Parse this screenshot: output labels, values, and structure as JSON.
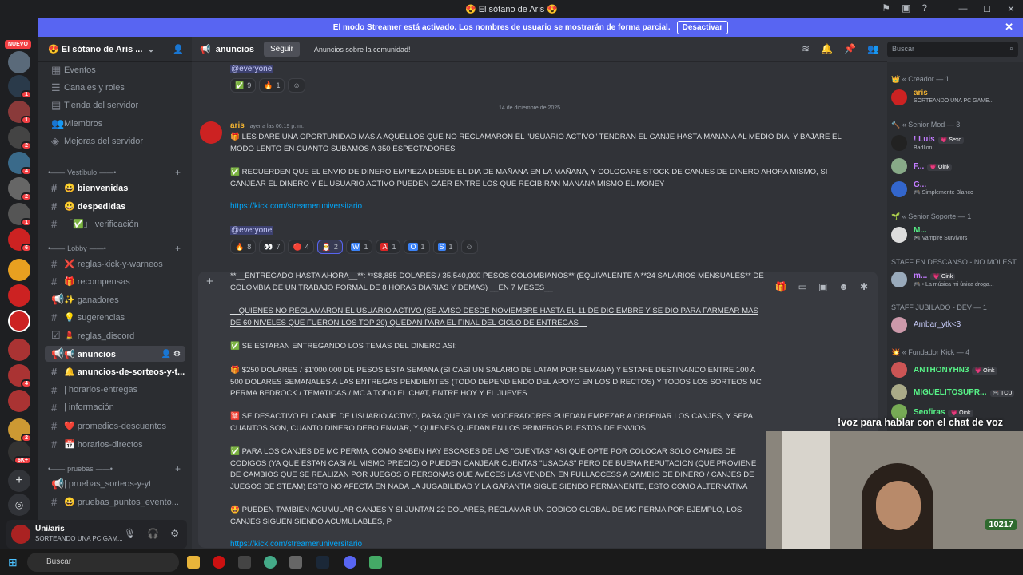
{
  "window": {
    "title": "😍 El sótano de Aris 😍"
  },
  "banner": {
    "text": "El modo Streamer está activado. Los nombres de usuario se mostrarán de forma parcial.",
    "button": "Desactivar"
  },
  "servers": {
    "new_label": "NUEVO"
  },
  "server": {
    "name": "😍 El sótano de Aris ..."
  },
  "nav": {
    "eventos": "Eventos",
    "canales": "Canales y roles",
    "tienda": "Tienda del servidor",
    "miembros": "Miembros",
    "mejoras": "Mejoras del servidor"
  },
  "categories": {
    "vestibulo": "Vestíbulo",
    "lobby": "Lobby",
    "pruebas": "pruebas"
  },
  "channels": [
    {
      "label": "😀 bienvenidas"
    },
    {
      "label": "😀 despedidas"
    },
    {
      "label": "「✅」 verificación"
    },
    {
      "label": "❌ reglas-kick-y-warneos"
    },
    {
      "label": "🎁 recompensas"
    },
    {
      "label": "✨ ganadores"
    },
    {
      "label": "💡 sugerencias"
    },
    {
      "label": "💄 reglas_discord"
    },
    {
      "label": "📢 anuncios"
    },
    {
      "label": "🔔 anuncios-de-sorteos-y-t..."
    },
    {
      "label": "| horarios-entregas"
    },
    {
      "label": "| información"
    },
    {
      "label": "❓ preguntas-frecuentes"
    },
    {
      "label": "❤️ promedios-descuentos"
    },
    {
      "label": "📅 horarios-directos"
    },
    {
      "label": "| pruebas_sorteos-y-yt"
    },
    {
      "label": "😀 pruebas_puntos_evento..."
    }
  ],
  "user": {
    "name": "Uni/aris",
    "status": "SORTEANDO UNA PC GAM..."
  },
  "channel": {
    "name": "anuncios",
    "follow": "Seguir",
    "topic": "Anuncios sobre la comunidad!"
  },
  "search": {
    "placeholder": "Buscar"
  },
  "messages": {
    "everyone": "@everyone",
    "top_reactions": [
      {
        "emoji": "✅",
        "count": "9"
      },
      {
        "emoji": "🔥",
        "count": "1"
      }
    ],
    "date_divider": "14 de diciembre de 2025",
    "author": "aris",
    "timestamp": "ayer a las 06:19 p. m.",
    "p1": "🎁 LES DARE UNA OPORTUNIDAD MAS A AQUELLOS QUE NO RECLAMARON EL \"USUARIO ACTIVO\" TENDRAN EL CANJE HASTA MAÑANA AL MEDIO DIA, Y BAJARE EL MODO LENTO EN CUANTO SUBAMOS A 350 ESPECTADORES",
    "p2": "✅ RECUERDEN QUE EL ENVIO DE DINERO EMPIEZA DESDE EL DIA DE MAÑANA EN LA MAÑANA, Y COLOCARE STOCK DE CANJES DE DINERO AHORA MISMO, SI CANJEAR EL DINERO Y EL USUARIO ACTIVO PUEDEN CAER ENTRE LOS QUE RECIBIRAN MAÑANA MISMO EL MONEY",
    "link": "https://kick.com/streameruniversitario",
    "reactions": [
      {
        "emoji": "🔥",
        "count": "8"
      },
      {
        "emoji": "👀",
        "count": "7"
      },
      {
        "emoji": "🔴",
        "count": "4"
      },
      {
        "emoji": "🎅",
        "count": "2"
      },
      {
        "emoji": "W",
        "count": "1"
      },
      {
        "emoji": "A",
        "count": "1"
      },
      {
        "emoji": "O",
        "count": "1"
      },
      {
        "emoji": "S",
        "count": "1"
      }
    ]
  },
  "draft": {
    "l1": "**__ENTREGADO HASTA AHORA__**: **$8,885 DOLARES / 35,540,000 PESOS COLOMBIANOS** (EQUIVALENTE A **24 SALARIOS MENSUALES** DE COLOMBIA DE UN TRABAJO FORMAL DE 8 HORAS DIARIAS Y DEMAS) __EN 7 MESES__",
    "l2": "__QUIENES NO RECLAMARON EL USUARIO ACTIVO (SE AVISO DESDE NOVIEMBRE HASTA EL 11 DE DICIEMBRE Y SE DIO PARA FARMEAR MAS DE 60 NIVELES QUE FUERON LOS TOP 20) QUEDAN PARA EL FINAL DEL CICLO DE ENTREGAS__",
    "l3": "✅ SE ESTARAN ENTREGANDO LOS TEMAS DEL DINERO ASI:",
    "l4": "🎁 $250 DOLARES / $1'000.000 DE PESOS ESTA SEMANA (SI CASI UN SALARIO DE LATAM POR SEMANA) Y ESTARE DESTINANDO ENTRE 100 A 500 DOLARES SEMANALES A LAS ENTREGAS PENDIENTES (TODO DEPENDIENDO DEL APOYO EN LOS DIRECTOS) Y TODOS LOS SORTEOS MC PERMA BEDROCK / TEMATICAS / MC A TODO EL CHAT, ENTRE HOY Y EL JUEVES",
    "l5": "🈲 SE DESACTIVO EL CANJE DE USUARIO ACTIVO, PARA QUE YA LOS MODERADORES PUEDAN EMPEZAR A ORDENAR LOS CANJES, Y SEPA CUANTOS SON, CUANTO DINERO DEBO ENVIAR, Y QUIENES QUEDAN EN LOS PRIMEROS PUESTOS DE ENVIOS",
    "l6": "✅ PARA LOS CANJES DE MC PERMA, COMO SABEN HAY ESCASES DE LAS \"CUENTAS\" ASI QUE OPTE POR COLOCAR SOLO CANJES DE CODIGOS (YA QUE ESTAN CASI AL MISMO PRECIO) O PUEDEN CANJEAR CUENTAS \"USADAS\" PERO DE BUENA REPUTACION (QUE PROVIENE DE CAMBIOS QUE SE REALIZAN POR JUEGOS O PERSONAS QUE AVECES LAS VENDEN EN FULLACCESS A CAMBIO DE DINERO / CANJES DE JUEGOS DE STEAM) ESTO NO AFECTA EN NADA LA JUGABILIDAD Y LA GARANTIA SIGUE SIENDO PERMANENTE, ESTO COMO ALTERNATIVA",
    "l7": "🤩 PUEDEN TAMBIEN ACUMULAR CANJES Y SI JUNTAN 22 DOLARES, RECLAMAR UN CODIGO GLOBAL DE MC PERMA POR EJEMPLO, LOS CANJES SIGUEN SIENDO ACUMULABLES, P"
  },
  "members": {
    "groups": [
      "👑 « Creador — 1",
      "🔨 « Senior Mod — 3",
      "🌱 « Senior Soporte — 1",
      "STAFF EN DESCANSO - NO MOLEST...",
      "STAFF JUBILADO - DEV — 1",
      "💥 « Fundador Kick — 4"
    ],
    "list": [
      {
        "name": "aris",
        "status": "SORTEANDO UNA PC GAME...",
        "tag": "",
        "color": "#f0b232"
      },
      {
        "name": "! Luis",
        "status": "Badlion",
        "tag": "💗 Sexo",
        "color": "#c27cff"
      },
      {
        "name": "F...",
        "status": "",
        "tag": "💗 Oink",
        "color": "#c27cff"
      },
      {
        "name": "G...",
        "status": "🎮 Simplemente Blanco",
        "tag": "",
        "color": "#c27cff"
      },
      {
        "name": "M...",
        "status": "🎮 Vampire Survivors",
        "tag": "",
        "color": "#57f287"
      },
      {
        "name": "m...",
        "status": "🎮 • La música mi única droga...",
        "tag": "💗 Oink",
        "color": "#c27cff"
      },
      {
        "name": "Ambar_ytk<3",
        "status": "",
        "tag": "",
        "color": "#c9cdfb"
      },
      {
        "name": "ANTHONYHN3",
        "status": "",
        "tag": "💗 Oink",
        "color": "#57f287"
      },
      {
        "name": "MIGUELITOSUPR...",
        "status": "",
        "tag": "🎮 TCU",
        "color": "#57f287"
      },
      {
        "name": "Seofiras",
        "status": "",
        "tag": "💗 Oink",
        "color": "#57f287"
      }
    ]
  },
  "stream": {
    "caption": "!voz para hablar con el chat de voz",
    "points": "10217"
  },
  "taskbar": {
    "search": "Buscar"
  }
}
